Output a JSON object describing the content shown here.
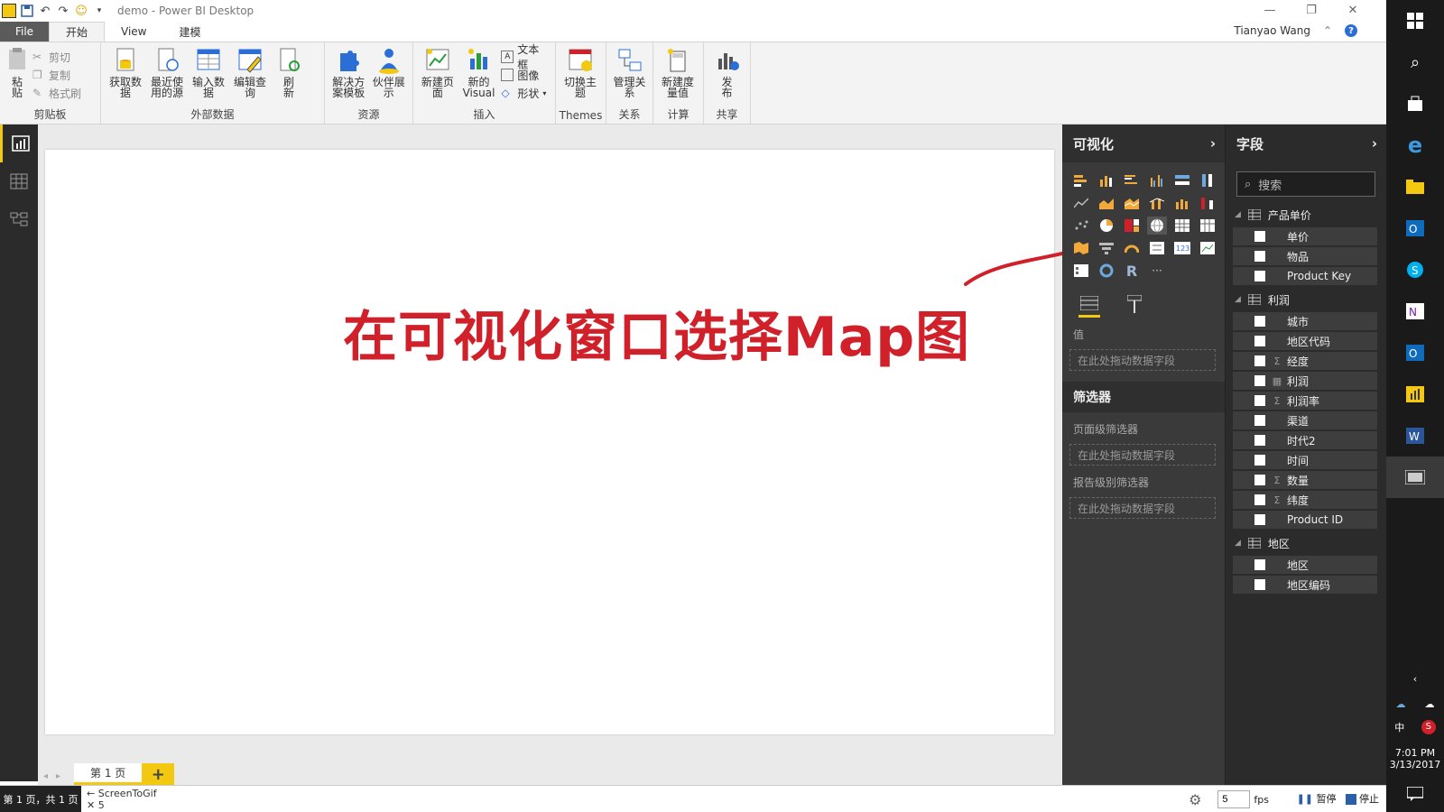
{
  "window": {
    "title": "demo - Power BI Desktop",
    "controls": [
      "minimize-icon",
      "restore-icon",
      "close-icon"
    ]
  },
  "menu": {
    "tabs": [
      "File",
      "开始",
      "View",
      "建模"
    ],
    "user": "Tianyao Wang"
  },
  "ribbon": {
    "clipboard": {
      "paste": "粘贴",
      "cut": "剪切",
      "copy": "复制",
      "format": "格式刷",
      "label": "剪贴板"
    },
    "external": {
      "get_data": "获取数据",
      "recent": "最近使用的源",
      "enter": "输入数据",
      "edit": "编辑查询",
      "refresh": "刷新",
      "label": "外部数据"
    },
    "resources": {
      "solution": "解决方案模板",
      "partner": "伙伴展示",
      "label": "资源"
    },
    "insert": {
      "new_page": "新建页面",
      "new_visual": "新的Visual",
      "textbox": "文本框",
      "image": "图像",
      "shapes": "形状",
      "label": "插入"
    },
    "themes": {
      "switch": "切换主题",
      "label": "Themes"
    },
    "relations": {
      "manage": "管理关系",
      "label": "关系"
    },
    "calc": {
      "new_measure": "新建度量值",
      "label": "计算"
    },
    "share": {
      "publish": "发布",
      "label": "共享"
    }
  },
  "canvas": {
    "annotation": "在可视化窗口选择Map图",
    "page_tab": "第 1 页",
    "add_page": "+"
  },
  "viz": {
    "title": "可视化",
    "values_label": "值",
    "drop_hint": "在此处拖动数据字段",
    "filters_title": "筛选器",
    "page_filters": "页面级筛选器",
    "report_filters": "报告级别筛选器",
    "more": "···"
  },
  "fields": {
    "title": "字段",
    "search_placeholder": "搜索",
    "tables": [
      {
        "name": "产品单价",
        "fields": [
          {
            "name": "单价",
            "sigma": ""
          },
          {
            "name": "物品",
            "sigma": ""
          },
          {
            "name": "Product Key",
            "sigma": ""
          }
        ]
      },
      {
        "name": "利润",
        "fields": [
          {
            "name": "城市",
            "sigma": ""
          },
          {
            "name": "地区代码",
            "sigma": ""
          },
          {
            "name": "经度",
            "sigma": "Σ"
          },
          {
            "name": "利润",
            "sigma": "▦"
          },
          {
            "name": "利润率",
            "sigma": "Σ"
          },
          {
            "name": "渠道",
            "sigma": ""
          },
          {
            "name": "时代2",
            "sigma": ""
          },
          {
            "name": "时间",
            "sigma": ""
          },
          {
            "name": "数量",
            "sigma": "Σ"
          },
          {
            "name": "纬度",
            "sigma": "Σ"
          },
          {
            "name": "Product ID",
            "sigma": ""
          }
        ]
      },
      {
        "name": "地区",
        "fields": [
          {
            "name": "地区",
            "sigma": ""
          },
          {
            "name": "地区编码",
            "sigma": ""
          }
        ]
      }
    ]
  },
  "status": {
    "page_info": "第 1 页，共 1 页",
    "recorder_name": "ScreenToGif",
    "recorder_count": "5",
    "fps_value": "5",
    "fps_label": "fps",
    "pause": "暂停",
    "stop": "停止"
  },
  "taskbar": {
    "ime": "中",
    "time": "7:01 PM",
    "date": "3/13/2017"
  },
  "colors": {
    "accent": "#f2c811",
    "annotation": "#d0202a",
    "pane_dark": "#3a3a3a"
  }
}
